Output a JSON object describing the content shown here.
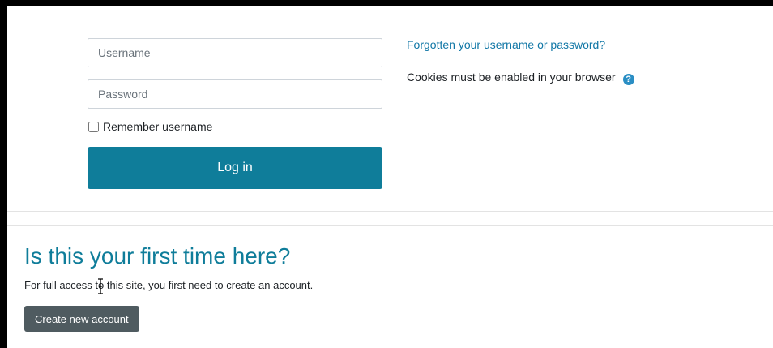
{
  "login": {
    "username_placeholder": "Username",
    "password_placeholder": "Password",
    "remember_label": "Remember username",
    "login_button_label": "Log in"
  },
  "side": {
    "forgot_link": "Forgotten your username or password?",
    "cookies_text": "Cookies must be enabled in your browser",
    "help_icon_glyph": "?"
  },
  "signup": {
    "title": "Is this your first time here?",
    "text": "For full access to this site, you first need to create an account.",
    "create_button_label": "Create new account"
  },
  "icons": {
    "help": "question-circle-icon",
    "cursor": "text-cursor-icon"
  },
  "colors": {
    "primary": "#0f7d9a",
    "link": "#1177a6",
    "secondary_button": "#4f5b60",
    "help_icon": "#2a8ec4"
  }
}
